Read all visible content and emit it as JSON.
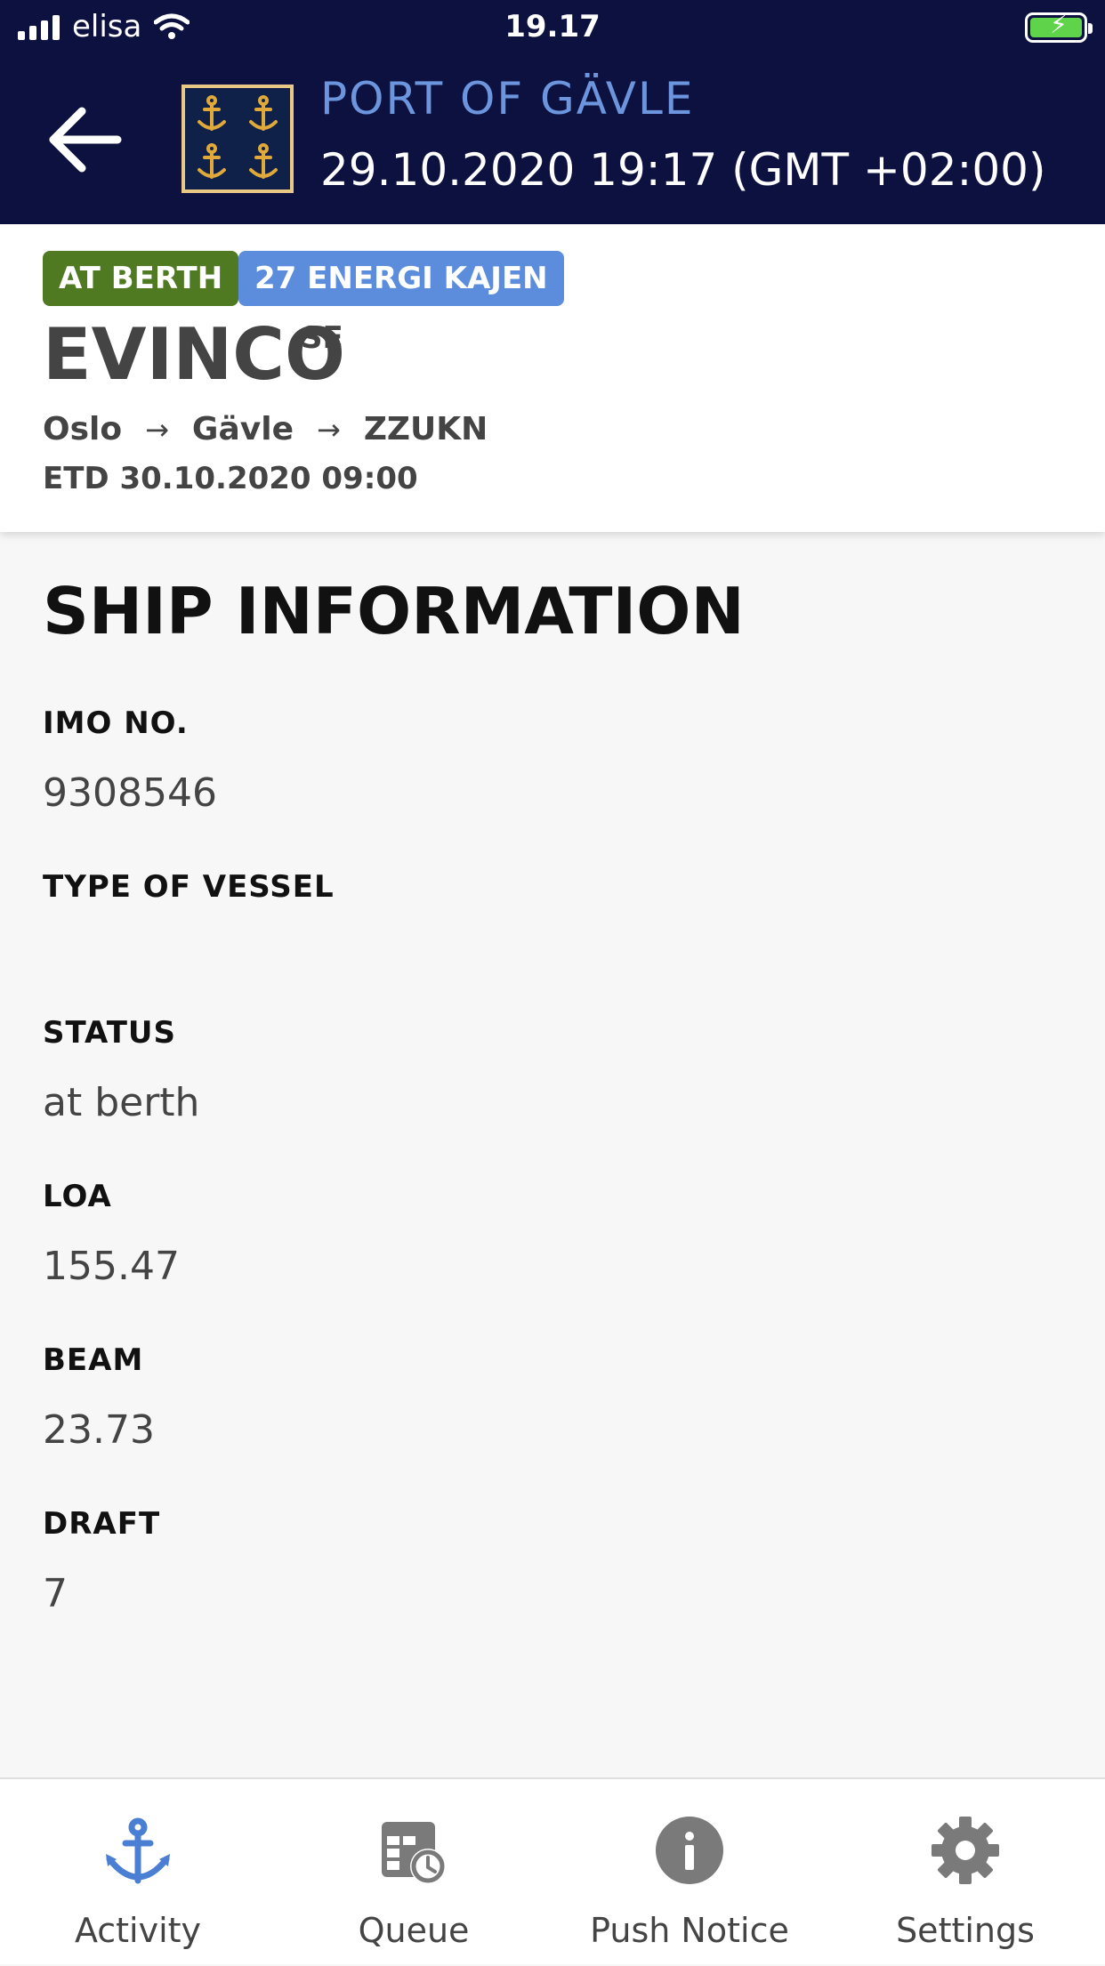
{
  "status_bar": {
    "carrier": "elisa",
    "time": "19.17"
  },
  "header": {
    "title": "PORT OF GÄVLE",
    "datetime": "29.10.2020 19:17 (GMT +02:00)"
  },
  "vessel": {
    "status_badge": "AT BERTH",
    "berth_badge": "27 ENERGI KAJEN",
    "name": "EVINCO",
    "flag": "SE",
    "route": [
      "Oslo",
      "Gävle",
      "ZZUKN"
    ],
    "etd": "ETD 30.10.2020 09:00"
  },
  "ship_info": {
    "title": "SHIP INFORMATION",
    "fields": [
      {
        "label": "IMO NO.",
        "value": "9308546"
      },
      {
        "label": "TYPE OF VESSEL",
        "value": ""
      },
      {
        "label": "STATUS",
        "value": "at berth"
      },
      {
        "label": "LOA",
        "value": "155.47"
      },
      {
        "label": "BEAM",
        "value": "23.73"
      },
      {
        "label": "DRAFT",
        "value": "7"
      }
    ]
  },
  "tabs": [
    {
      "label": "Activity",
      "icon": "anchor-icon",
      "active": true
    },
    {
      "label": "Queue",
      "icon": "queue-calendar-icon",
      "active": false
    },
    {
      "label": "Push Notice",
      "icon": "info-icon",
      "active": false
    },
    {
      "label": "Settings",
      "icon": "gear-icon",
      "active": false
    }
  ],
  "colors": {
    "header_bg": "#0c1140",
    "accent": "#6c95dd",
    "berth_badge": "#4f7a22",
    "quay_badge": "#5b8ddc",
    "active_tab": "#4a7fd4",
    "inactive_tab": "#7a7a7a"
  }
}
